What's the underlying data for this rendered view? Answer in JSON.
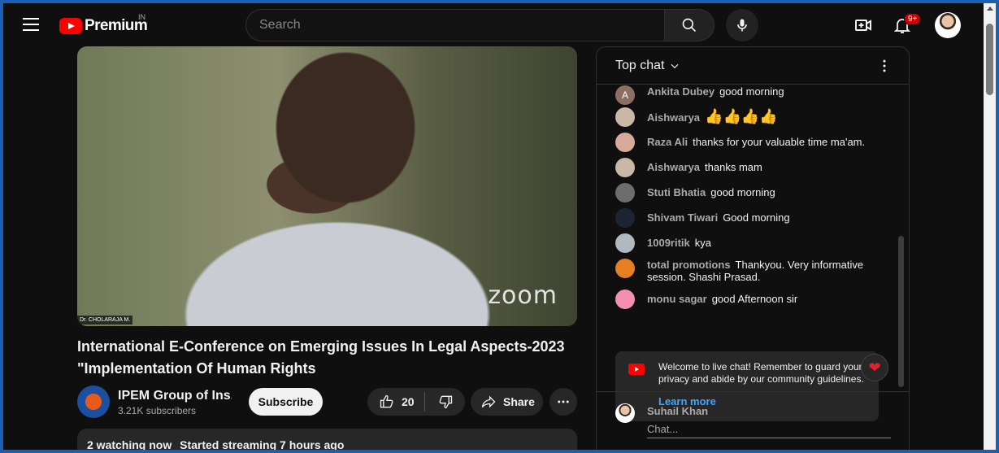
{
  "header": {
    "logo_text": "Premium",
    "country_code": "IN",
    "search_placeholder": "Search",
    "notification_count": "9+"
  },
  "video": {
    "overlay_watermark": "zoom",
    "speaker_tag": "Dr. CHOLARAJA M.",
    "title": "International E-Conference on Emerging Issues In Legal Aspects-2023 \"Implementation Of Human Rights",
    "channel_name": "IPEM Group of Ins...",
    "subscribers": "3.21K subscribers",
    "subscribe_label": "Subscribe",
    "like_count": "20",
    "share_label": "Share",
    "watching": "2 watching now",
    "started": "Started streaming 7 hours ago"
  },
  "chat": {
    "mode_label": "Top chat",
    "messages": [
      {
        "author": "Ankita Dubey",
        "text": "good morning",
        "avatar_letter": "A",
        "avatar_color": "#8d6e63"
      },
      {
        "author": "Aishwarya",
        "text": "👍👍👍👍",
        "avatar_color": "#c9b8a6"
      },
      {
        "author": "Raza Ali",
        "text": "thanks for your valuable time ma'am.",
        "avatar_color": "#d7a99a"
      },
      {
        "author": "Aishwarya",
        "text": "thanks mam",
        "avatar_color": "#c9b8a6"
      },
      {
        "author": "Stuti Bhatia",
        "text": "good morning",
        "avatar_color": "#6d6d6d"
      },
      {
        "author": "Shivam Tiwari",
        "text": "Good morning",
        "avatar_color": "#1c2333"
      },
      {
        "author": "1009ritik",
        "text": "kya",
        "avatar_color": "#b0b8c0"
      },
      {
        "author": "total promotions",
        "text": "Thankyou. Very informative session. Shashi Prasad.",
        "avatar_color": "#e67e22"
      },
      {
        "author": "monu sagar",
        "text": "good Afternoon sir",
        "avatar_color": "#f48fb1"
      }
    ],
    "welcome_text": "Welcome to live chat! Remember to guard your privacy and abide by our community guidelines.",
    "learn_more": "Learn more",
    "input_user": "Suhail Khan",
    "input_placeholder": "Chat..."
  }
}
